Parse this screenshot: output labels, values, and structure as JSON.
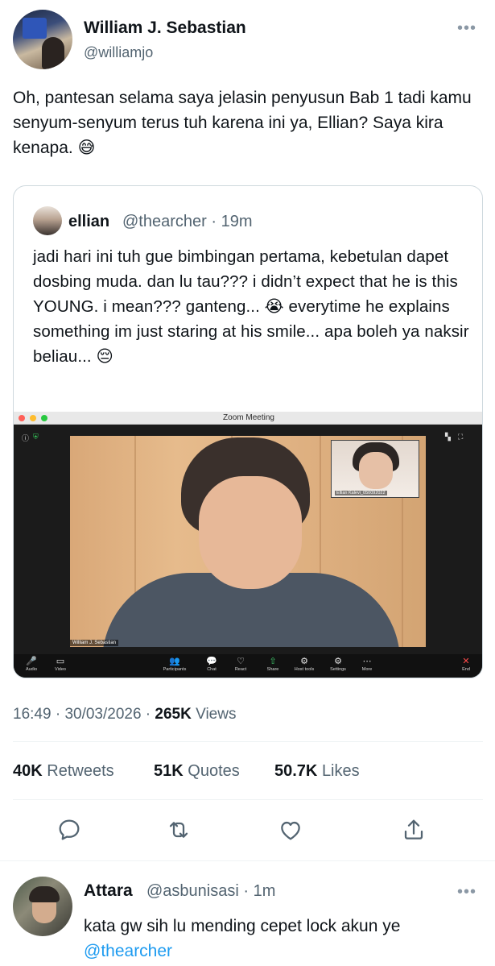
{
  "tweet": {
    "author_name": "William J. Sebastian",
    "author_handle": "@williamjo",
    "text": "Oh, pantesan selama saya jelasin penyusun Bab 1 tadi kamu senyum-senyum terus tuh karena ini ya, Ellian? Saya kira kenapa. 😅",
    "more": "•••",
    "time": "16:49",
    "date": "30/03/2026",
    "sep": " · ",
    "views_count": "265K",
    "views_label": "Views"
  },
  "quote": {
    "author_name": "ellian",
    "author_handle": "@thearcher · 19m",
    "text": "jadi hari ini tuh gue bimbingan pertama, kebetulan dapet dosbing muda. dan lu tau??? i didn’t expect that he is this YOUNG. i mean??? ganteng... 😭 everytime he explains something im just staring at his smile... apa boleh ya naksir beliau... 😔"
  },
  "zoom": {
    "window_title": "Zoom Meeting",
    "main_name_tag": "William J. Sebastian",
    "thumb_name_tag": "Ellian Kalevi_050092022",
    "toolbar": [
      {
        "icon": "🎤",
        "label": "Audio"
      },
      {
        "icon": "▭",
        "label": "Video"
      },
      {
        "icon": "👥",
        "label": "Participants"
      },
      {
        "icon": "💬",
        "label": "Chat"
      },
      {
        "icon": "♡",
        "label": "React"
      },
      {
        "icon": "⇧",
        "label": "Share"
      },
      {
        "icon": "⚙",
        "label": "Host tools"
      },
      {
        "icon": "⚙",
        "label": "Settings"
      },
      {
        "icon": "⋯",
        "label": "More"
      },
      {
        "icon": "✕",
        "label": "End"
      }
    ],
    "participants_count": "2"
  },
  "stats": {
    "retweets_count": "40K",
    "retweets_label": "Retweets",
    "quotes_count": "51K",
    "quotes_label": "Quotes",
    "likes_count": "50.7K",
    "likes_label": "Likes"
  },
  "actions": [
    "reply-icon",
    "retweet-icon",
    "like-icon",
    "share-icon"
  ],
  "reply": {
    "author_name": "Attara",
    "author_handle": "@asbunisasi · 1m",
    "text": "kata gw sih lu mending cepet lock akun ye",
    "mention": "@thearcher",
    "more": "•••"
  },
  "colors": {
    "accent": "#1d9bf0",
    "secondary_text": "#536471",
    "primary_text": "#0f1419",
    "divider": "#eff3f4"
  }
}
